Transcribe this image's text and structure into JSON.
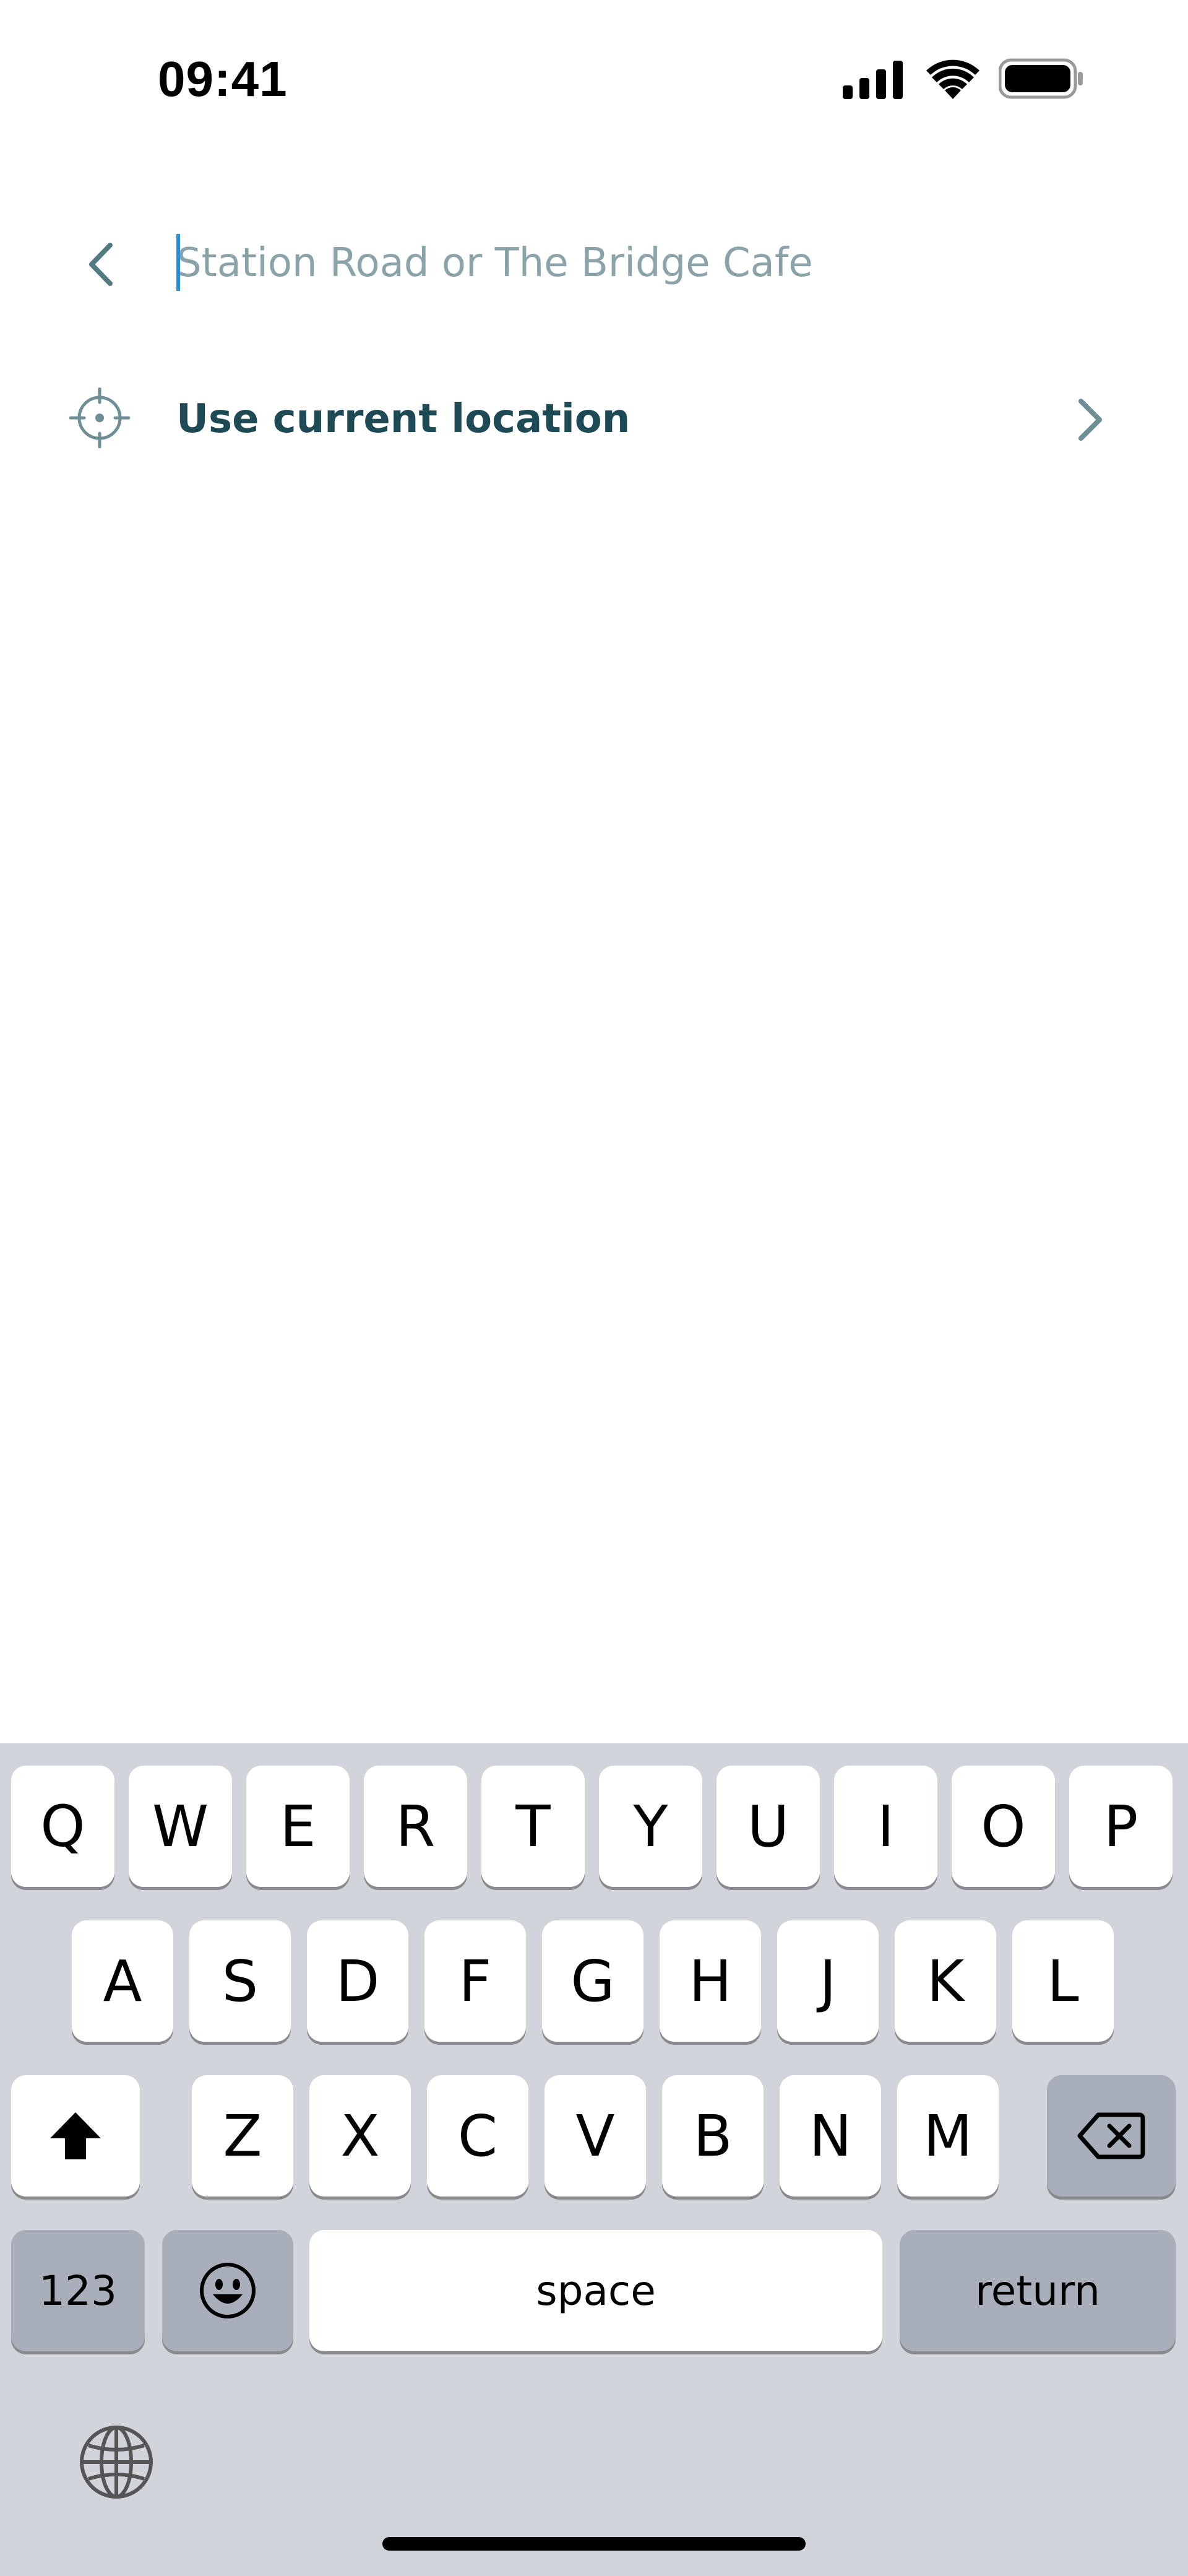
{
  "status_bar": {
    "time": "09:41",
    "icons": [
      "cellular-signal-icon",
      "wifi-icon",
      "battery-icon"
    ]
  },
  "search": {
    "back_icon": "chevron-left-icon",
    "placeholder": "Station Road or The Bridge Cafe",
    "value": ""
  },
  "location_option": {
    "icon": "crosshair-target-icon",
    "label": "Use current location",
    "chevron": "chevron-right-icon"
  },
  "keyboard": {
    "row1": [
      "Q",
      "W",
      "E",
      "R",
      "T",
      "Y",
      "U",
      "I",
      "O",
      "P"
    ],
    "row2": [
      "A",
      "S",
      "D",
      "F",
      "G",
      "H",
      "J",
      "K",
      "L"
    ],
    "row3": [
      "Z",
      "X",
      "C",
      "V",
      "B",
      "N",
      "M"
    ],
    "shift_icon": "shift-arrow-icon",
    "delete_icon": "backspace-icon",
    "numbers_label": "123",
    "emoji_icon": "emoji-icon",
    "space_label": "space",
    "return_label": "return",
    "globe_icon": "globe-icon"
  },
  "colors": {
    "accent_caret": "#2a8fd6",
    "primary_text": "#1d4a55",
    "placeholder_text": "#8aa3a9",
    "keyboard_bg": "#d1d4db"
  }
}
